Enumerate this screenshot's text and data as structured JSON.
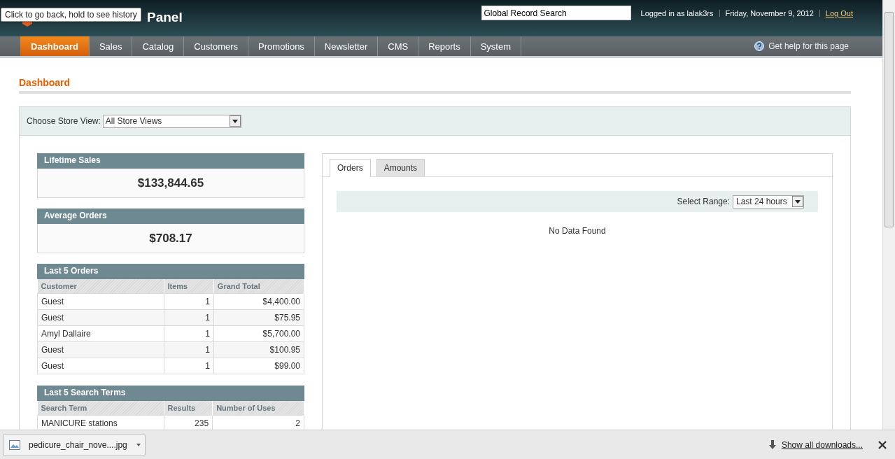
{
  "header": {
    "logo_text": "Panel",
    "tooltip": "Click to go back, hold to see history",
    "search": {
      "value": "Global Record Search"
    },
    "user": "Logged in as lalak3rs",
    "date": "Friday, November 9, 2012",
    "logout": "Log Out"
  },
  "nav": [
    {
      "label": "Dashboard",
      "selected": true
    },
    {
      "label": "Sales",
      "selected": false
    },
    {
      "label": "Catalog",
      "selected": false
    },
    {
      "label": "Customers",
      "selected": false
    },
    {
      "label": "Promotions",
      "selected": false
    },
    {
      "label": "Newsletter",
      "selected": false
    },
    {
      "label": "CMS",
      "selected": false
    },
    {
      "label": "Reports",
      "selected": false
    },
    {
      "label": "System",
      "selected": false
    }
  ],
  "help": "Get help for this page",
  "page_title": "Dashboard",
  "store_view": {
    "label": "Choose Store View:",
    "value": "All Store Views"
  },
  "stats": [
    {
      "title": "Lifetime Sales",
      "value": "$133,844.65"
    },
    {
      "title": "Average Orders",
      "value": "$708.17"
    }
  ],
  "grids": [
    {
      "title": "Last 5 Orders",
      "columns": [
        "Customer",
        "Items",
        "Grand Total"
      ],
      "rows": [
        [
          "Guest",
          "1",
          "$4,400.00"
        ],
        [
          "Guest",
          "1",
          "$75.95"
        ],
        [
          "Amyl Dallaire",
          "1",
          "$5,700.00"
        ],
        [
          "Guest",
          "1",
          "$100.95"
        ],
        [
          "Guest",
          "1",
          "$99.00"
        ]
      ]
    },
    {
      "title": "Last 5 Search Terms",
      "columns": [
        "Search Term",
        "Results",
        "Number of Uses"
      ],
      "rows": [
        [
          "MANICURE stations",
          "235",
          "2"
        ]
      ]
    }
  ],
  "chart_panel": {
    "tabs": [
      {
        "label": "Orders",
        "selected": true
      },
      {
        "label": "Amounts",
        "selected": false
      }
    ],
    "range_label": "Select Range:",
    "range_value": "Last 24 hours",
    "message": "No Data Found"
  },
  "downloads": {
    "file": "pedicure_chair_nove....jpg",
    "show_all": "Show all downloads..."
  }
}
